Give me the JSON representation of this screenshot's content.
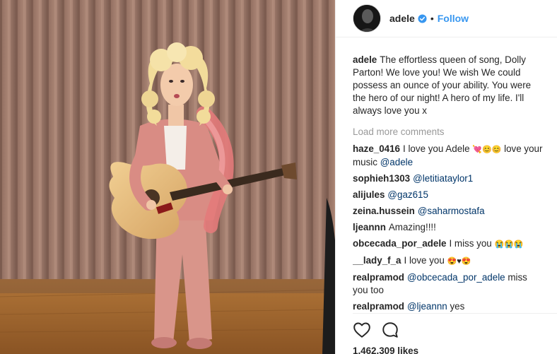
{
  "header": {
    "username": "adele",
    "follow_label": "Follow",
    "separator": "•"
  },
  "caption": {
    "username": "adele",
    "text": "The effortless queen of song, Dolly Parton! We love you! We wish We could possess an ounce of your ability. You were the hero of our night! A hero of my life. I'll always love you x"
  },
  "load_more_label": "Load more comments",
  "comments": [
    {
      "username": "haze_0416",
      "text": "I love you Adele",
      "emoji": "💘😊😊",
      "tail": "love your music",
      "mention": "@adele"
    },
    {
      "username": "sophieh1303",
      "mention": "@letitiataylor1"
    },
    {
      "username": "alijules",
      "mention": "@gaz615"
    },
    {
      "username": "zeina.hussein",
      "mention": "@saharmostafa"
    },
    {
      "username": "ljeannn",
      "text": "Amazing!!!!"
    },
    {
      "username": "obcecada_por_adele",
      "text": "I miss you",
      "emoji": "😭😭😭"
    },
    {
      "username": "__lady_f_a",
      "text": "I love you",
      "emoji": "😍♥😍"
    },
    {
      "username": "realpramod",
      "mention": "@obcecada_por_adele",
      "tail": "miss you too"
    },
    {
      "username": "realpramod",
      "mention": "@ljeannn",
      "tail": "yes"
    }
  ],
  "actions": {
    "like_icon": "heart-icon",
    "comment_icon": "speech-bubble-icon",
    "likes_text": "1,462,309 likes"
  },
  "colors": {
    "link_blue": "#3897f0",
    "mention_blue": "#003569",
    "muted_gray": "#999999",
    "text": "#262626"
  }
}
